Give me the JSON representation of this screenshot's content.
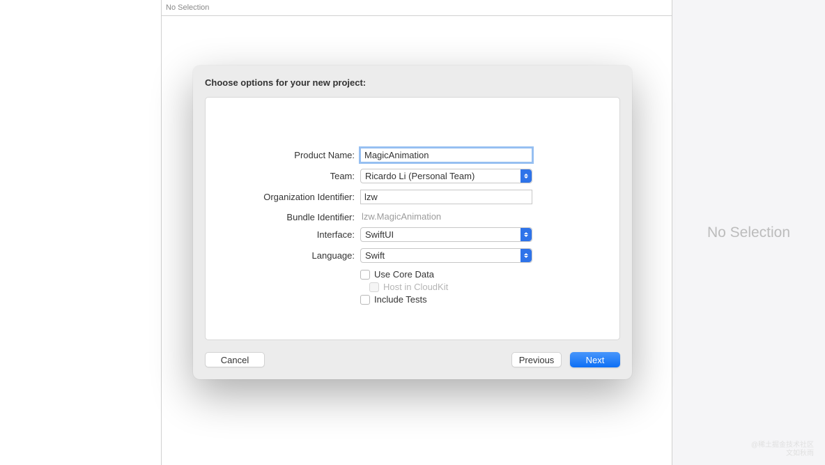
{
  "background": {
    "topbar_status": "No Selection",
    "right_panel_text": "No Selection"
  },
  "modal": {
    "title": "Choose options for your new project:",
    "labels": {
      "product_name": "Product Name:",
      "team": "Team:",
      "org_id": "Organization Identifier:",
      "bundle_id": "Bundle Identifier:",
      "interface": "Interface:",
      "language": "Language:"
    },
    "values": {
      "product_name": "MagicAnimation",
      "team": "Ricardo Li (Personal Team)",
      "org_id": "lzw",
      "bundle_id": "lzw.MagicAnimation",
      "interface": "SwiftUI",
      "language": "Swift"
    },
    "checkboxes": {
      "core_data": "Use Core Data",
      "cloudkit": "Host in CloudKit",
      "tests": "Include Tests"
    },
    "buttons": {
      "cancel": "Cancel",
      "previous": "Previous",
      "next": "Next"
    }
  },
  "watermark": {
    "line1": "@稀土掘金技术社区",
    "line2": "文如秋雨"
  }
}
